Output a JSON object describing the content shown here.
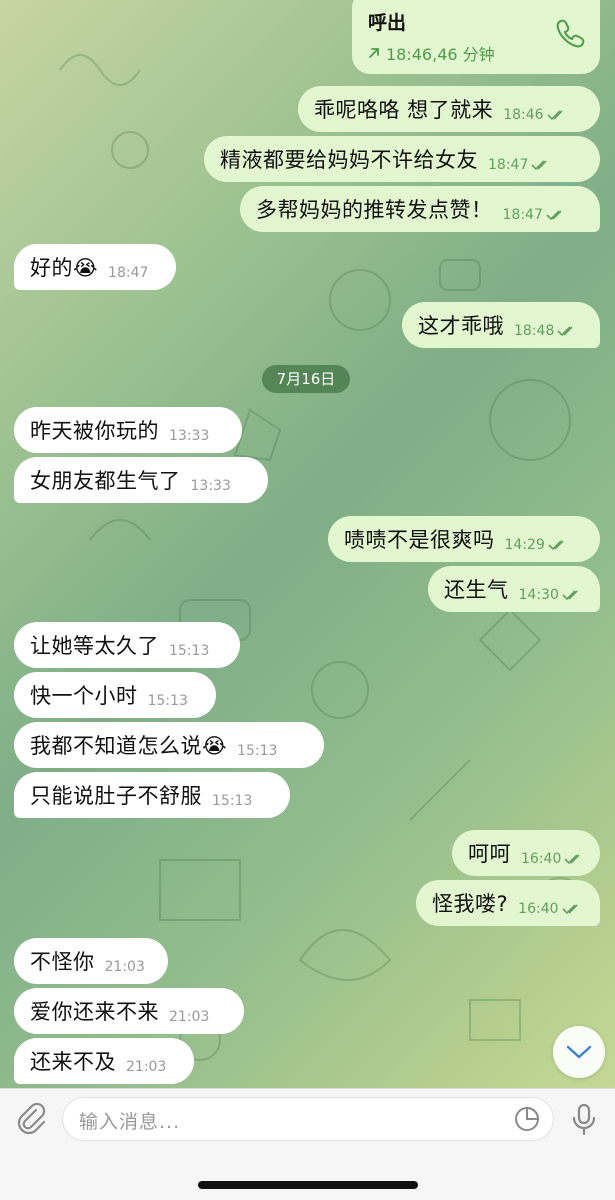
{
  "call": {
    "title": "呼出",
    "meta": "18:46,46 分钟"
  },
  "date_divider": "7月16日",
  "messages": [
    {
      "dir": "out",
      "text": "乖呢咯咯 想了就来",
      "time": "18:46"
    },
    {
      "dir": "out",
      "text": "精液都要给妈妈不许给女友",
      "time": "18:47"
    },
    {
      "dir": "out",
      "text": "多帮妈妈的推转发点赞！",
      "time": "18:47"
    },
    {
      "dir": "in",
      "text": "好的😭",
      "time": "18:47"
    },
    {
      "dir": "out",
      "text": "这才乖哦",
      "time": "18:48"
    },
    {
      "dir": "in",
      "text": "昨天被你玩的",
      "time": "13:33"
    },
    {
      "dir": "in",
      "text": "女朋友都生气了",
      "time": "13:33"
    },
    {
      "dir": "out",
      "text": "啧啧不是很爽吗",
      "time": "14:29"
    },
    {
      "dir": "out",
      "text": "还生气",
      "time": "14:30"
    },
    {
      "dir": "in",
      "text": "让她等太久了",
      "time": "15:13"
    },
    {
      "dir": "in",
      "text": "快一个小时",
      "time": "15:13"
    },
    {
      "dir": "in",
      "text": "我都不知道怎么说😭",
      "time": "15:13"
    },
    {
      "dir": "in",
      "text": "只能说肚子不舒服",
      "time": "15:13"
    },
    {
      "dir": "out",
      "text": "呵呵",
      "time": "16:40"
    },
    {
      "dir": "out",
      "text": "怪我喽?",
      "time": "16:40"
    },
    {
      "dir": "in",
      "text": "不怪你",
      "time": "21:03"
    },
    {
      "dir": "in",
      "text": "爱你还来不来",
      "time": "21:03"
    },
    {
      "dir": "in",
      "text": "还来不及",
      "time": "21:03"
    }
  ],
  "input": {
    "placeholder": "输入消息..."
  },
  "icons": {
    "attach": "paperclip-icon",
    "phone": "phone-icon",
    "sticker": "sticker-icon",
    "mic": "microphone-icon",
    "scroll": "chevron-down-icon",
    "read": "double-check-icon"
  },
  "colors": {
    "outgoing_bubble": "#e2f7cf",
    "incoming_bubble": "#ffffff",
    "accent_green": "#4e9b4a",
    "input_bar": "#f6f6f6"
  }
}
